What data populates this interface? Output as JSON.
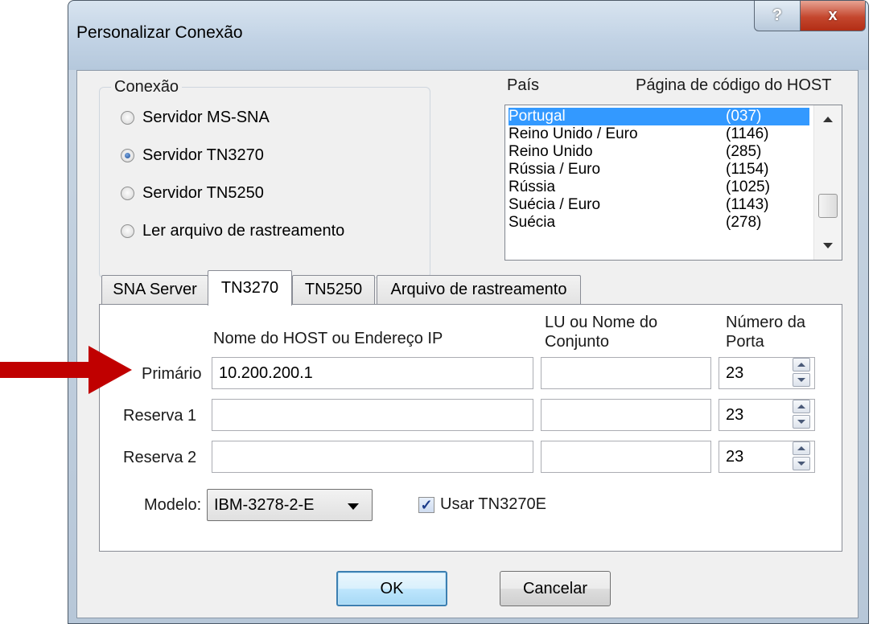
{
  "window": {
    "title": "Personalizar Conexão",
    "help_label": "?",
    "close_label": "x"
  },
  "connection_group": {
    "label": "Conexão",
    "options": [
      {
        "label": "Servidor MS-SNA",
        "checked": false
      },
      {
        "label": "Servidor TN3270",
        "checked": true
      },
      {
        "label": "Servidor TN5250",
        "checked": false
      },
      {
        "label": "Ler arquivo de rastreamento",
        "checked": false
      }
    ]
  },
  "country_list": {
    "header_country": "País",
    "header_codepage": "Página de código do HOST",
    "rows": [
      {
        "country": "Portugal",
        "code": "(037)",
        "selected": true
      },
      {
        "country": "Reino Unido / Euro",
        "code": "(1146)",
        "selected": false
      },
      {
        "country": "Reino Unido",
        "code": "(285)",
        "selected": false
      },
      {
        "country": "Rússia / Euro",
        "code": "(1154)",
        "selected": false
      },
      {
        "country": "Rússia",
        "code": "(1025)",
        "selected": false
      },
      {
        "country": "Suécia / Euro",
        "code": "(1143)",
        "selected": false
      },
      {
        "country": "Suécia",
        "code": "(278)",
        "selected": false
      }
    ]
  },
  "tabs": [
    {
      "label": "SNA Server",
      "active": false
    },
    {
      "label": "TN3270",
      "active": true
    },
    {
      "label": "TN5250",
      "active": false
    },
    {
      "label": "Arquivo de rastreamento",
      "active": false
    }
  ],
  "tn3270": {
    "col_host": "Nome do HOST ou Endereço IP",
    "col_lu_line1": "LU ou Nome do",
    "col_lu_line2": "Conjunto",
    "col_port_line1": "Número da",
    "col_port_line2": "Porta",
    "rows": [
      {
        "label": "Primário",
        "host": "10.200.200.1",
        "lu": "",
        "port": "23"
      },
      {
        "label": "Reserva 1",
        "host": "",
        "lu": "",
        "port": "23"
      },
      {
        "label": "Reserva 2",
        "host": "",
        "lu": "",
        "port": "23"
      }
    ],
    "model_label": "Modelo:",
    "model_value": "IBM-3278-2-E",
    "use_tn3270e_label": "Usar TN3270E",
    "use_tn3270e_checked": true
  },
  "buttons": {
    "ok": "OK",
    "cancel": "Cancelar"
  },
  "colors": {
    "selection": "#3399ff",
    "annotation_arrow": "#c00000",
    "close_button": "#c4472e"
  },
  "annotation": {
    "arrow_icon": "red-arrow-icon"
  }
}
